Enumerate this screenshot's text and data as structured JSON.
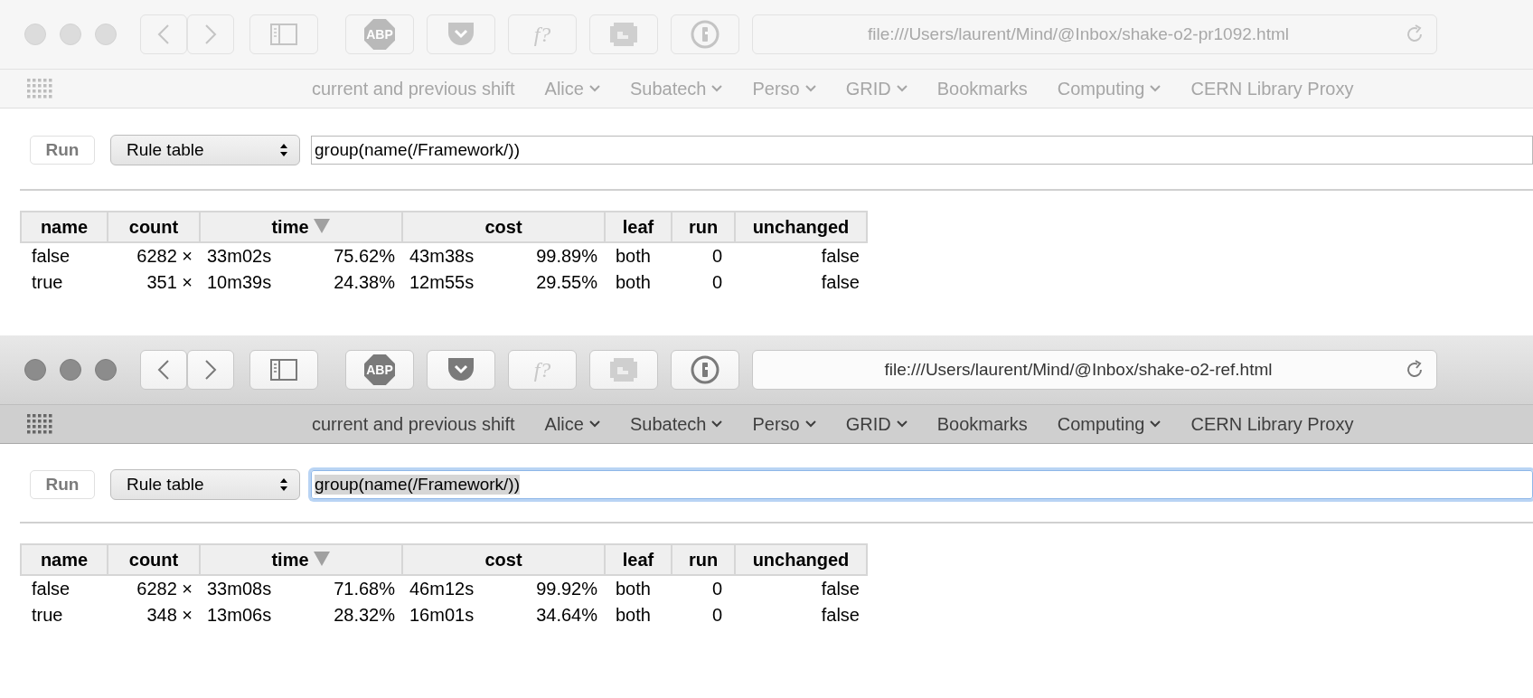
{
  "windows": [
    {
      "active": false,
      "toolbar": {
        "extensions": [
          {
            "kind": "abp",
            "label": "ABP"
          },
          {
            "kind": "pocket"
          },
          {
            "kind": "text",
            "label": "f?"
          },
          {
            "kind": "pixel"
          },
          {
            "kind": "keyhole"
          }
        ],
        "url": "file:///Users/laurent/Mind/@Inbox/shake-o2-pr1092.html"
      },
      "bookmarks": [
        {
          "label": "current and previous shift",
          "menu": false
        },
        {
          "label": "Alice",
          "menu": true
        },
        {
          "label": "Subatech",
          "menu": true
        },
        {
          "label": "Perso",
          "menu": true
        },
        {
          "label": "GRID",
          "menu": true
        },
        {
          "label": "Bookmarks",
          "menu": false
        },
        {
          "label": "Computing",
          "menu": true
        },
        {
          "label": "CERN Library Proxy",
          "menu": false
        }
      ],
      "page": {
        "run_button": "Run",
        "view_select": "Rule table",
        "query": {
          "value": "group(name(/Framework/))",
          "focused": false
        },
        "table": {
          "columns": [
            {
              "label": "name",
              "sorted": false
            },
            {
              "label": "count",
              "sorted": false
            },
            {
              "label": "time",
              "sorted": true
            },
            {
              "label": "cost",
              "sorted": false
            },
            {
              "label": "leaf",
              "sorted": false
            },
            {
              "label": "run",
              "sorted": false
            },
            {
              "label": "unchanged",
              "sorted": false
            }
          ],
          "rows": [
            [
              "false",
              "6282 ×",
              [
                "33m02s",
                "75.62%"
              ],
              [
                "43m38s",
                "99.89%"
              ],
              "both",
              "0",
              "false"
            ],
            [
              "true",
              "351 ×",
              [
                "10m39s",
                "24.38%"
              ],
              [
                "12m55s",
                "29.55%"
              ],
              "both",
              "0",
              "false"
            ]
          ]
        }
      }
    },
    {
      "active": true,
      "toolbar": {
        "extensions": [
          {
            "kind": "abp",
            "label": "ABP"
          },
          {
            "kind": "pocket"
          },
          {
            "kind": "text",
            "label": "f?"
          },
          {
            "kind": "pixel"
          },
          {
            "kind": "keyhole"
          }
        ],
        "url": "file:///Users/laurent/Mind/@Inbox/shake-o2-ref.html"
      },
      "bookmarks": [
        {
          "label": "current and previous shift",
          "menu": false
        },
        {
          "label": "Alice",
          "menu": true
        },
        {
          "label": "Subatech",
          "menu": true
        },
        {
          "label": "Perso",
          "menu": true
        },
        {
          "label": "GRID",
          "menu": true
        },
        {
          "label": "Bookmarks",
          "menu": false
        },
        {
          "label": "Computing",
          "menu": true
        },
        {
          "label": "CERN Library Proxy",
          "menu": false
        }
      ],
      "page": {
        "run_button": "Run",
        "view_select": "Rule table",
        "query": {
          "value": "group(name(/Framework/))",
          "focused": true
        },
        "table": {
          "columns": [
            {
              "label": "name",
              "sorted": false
            },
            {
              "label": "count",
              "sorted": false
            },
            {
              "label": "time",
              "sorted": true
            },
            {
              "label": "cost",
              "sorted": false
            },
            {
              "label": "leaf",
              "sorted": false
            },
            {
              "label": "run",
              "sorted": false
            },
            {
              "label": "unchanged",
              "sorted": false
            }
          ],
          "rows": [
            [
              "false",
              "6282 ×",
              [
                "33m08s",
                "71.68%"
              ],
              [
                "46m12s",
                "99.92%"
              ],
              "both",
              "0",
              "false"
            ],
            [
              "true",
              "348 ×",
              [
                "13m06s",
                "28.32%"
              ],
              [
                "16m01s",
                "34.64%"
              ],
              "both",
              "0",
              "false"
            ]
          ]
        }
      }
    }
  ]
}
